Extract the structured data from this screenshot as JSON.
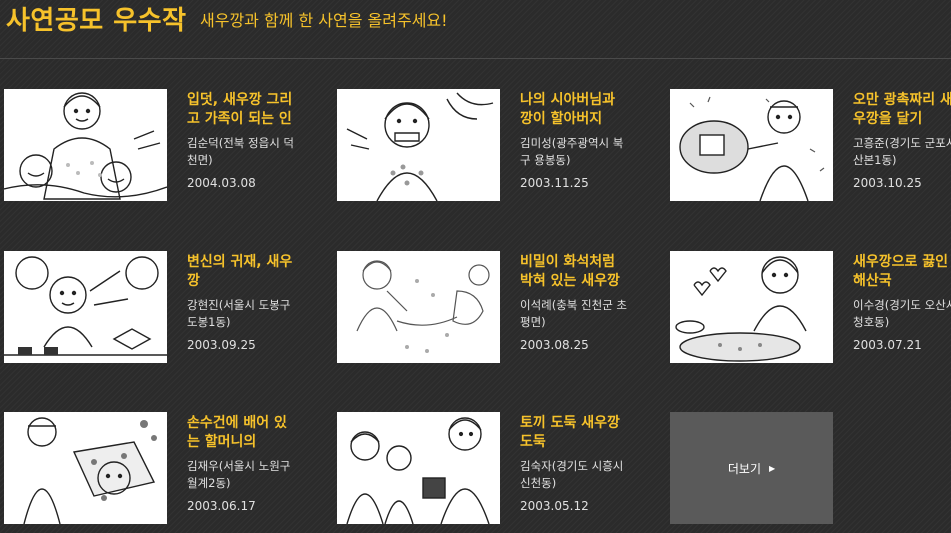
{
  "header": {
    "title": "사연공모 우수작",
    "subtitle": "새우깡과 함께 한 사연을 올려주세요!"
  },
  "cards": [
    {
      "title": "입덧, 새우깡 그리고 가족이 되는 인연",
      "author": "김순덕(전북 정읍시 덕천면)",
      "date": "2004.03.08"
    },
    {
      "title": "나의 시아버님과 깡이 할아버지",
      "author": "김미성(광주광역시 북구 용봉동)",
      "date": "2003.11.25"
    },
    {
      "title": "오만 광촉짜리 새우깡을 달기",
      "author": "고흥준(경기도 군포시 산본1동)",
      "date": "2003.10.25"
    },
    {
      "title": "변신의 귀재, 새우깡",
      "author": "강현진(서울시 도봉구 도봉1동)",
      "date": "2003.09.25"
    },
    {
      "title": "비밀이 화석처럼 박혀 있는 새우깡",
      "author": "이석례(충북 진천군 초평면)",
      "date": "2003.08.25"
    },
    {
      "title": "새우깡으로 끓인 해산국",
      "author": "이수경(경기도 오산시 청호동)",
      "date": "2003.07.21"
    },
    {
      "title": "손수건에 배어 있는 할머니의",
      "author": "김재우(서울시 노원구 월계2동)",
      "date": "2003.06.17"
    },
    {
      "title": "토끼 도둑 새우깡 도둑",
      "author": "김숙자(경기도 시흥시 신천동)",
      "date": "2003.05.12"
    }
  ],
  "more": {
    "label": "더보기",
    "arrow": "▶"
  }
}
